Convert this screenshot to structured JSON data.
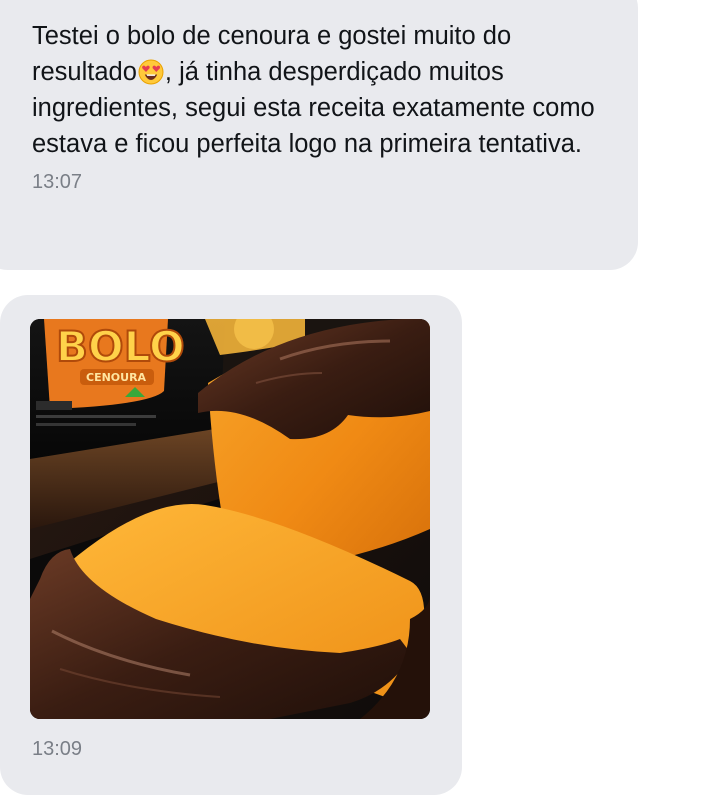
{
  "messages": [
    {
      "text_before_emoji": "Testei o bolo de cenoura e gostei muito do resultado",
      "emoji": "smiling-face-with-heart-eyes",
      "text_after_emoji": ", já tinha desperdiçado muitos ingredientes, segui esta receita exatamente como estava e ficou perfeita logo na primeira tentativa.",
      "time": "13:07"
    },
    {
      "image": {
        "subject": "carrot cake with chocolate icing",
        "package_label": "BOLO",
        "package_sublabel": "CENOURA"
      },
      "time": "13:09"
    }
  ],
  "colors": {
    "bubble": "#e9eaee",
    "text": "#111418",
    "time": "#7a7f87",
    "cake_crumb": "#f39a1f",
    "chocolate": "#3a1d12"
  }
}
